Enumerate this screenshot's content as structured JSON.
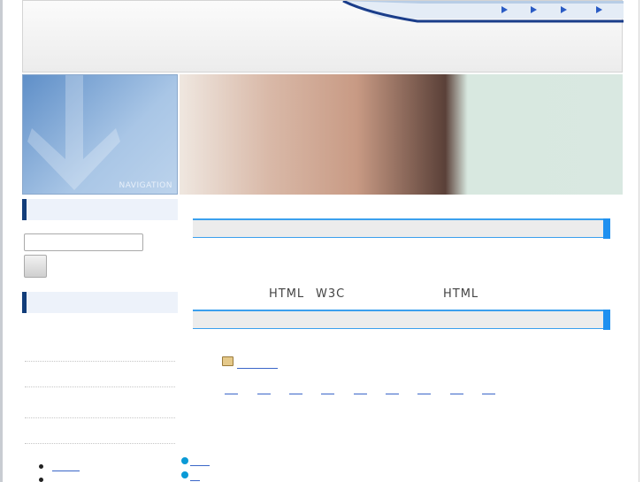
{
  "header": {
    "nav_items": 4
  },
  "navigation": {
    "label": "NAVIGATION"
  },
  "search": {
    "value": "",
    "placeholder": ""
  },
  "content": {
    "text_html_1": "HTML",
    "text_w3c": "W3C",
    "text_html_2": "HTML"
  },
  "colors": {
    "accent": "#1e90f0",
    "sidebar_bar": "#123d7a",
    "link": "#3a66c8",
    "bullet": "#0a9ad6"
  }
}
